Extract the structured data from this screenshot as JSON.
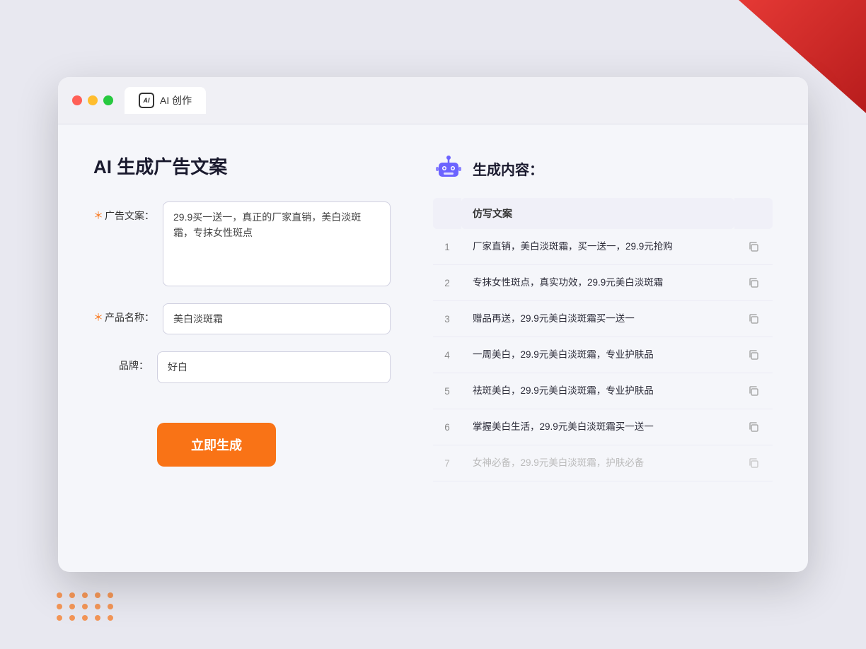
{
  "decorations": {
    "corner_color": "#e53935"
  },
  "browser": {
    "tab_label": "AI 创作",
    "tab_icon_text": "AI"
  },
  "left_panel": {
    "title": "AI 生成广告文案",
    "form": {
      "ad_copy_label": "广告文案：",
      "ad_copy_required": "＊",
      "ad_copy_value": "29.9买一送一，真正的厂家直销，美白淡斑霜，专抹女性斑点",
      "product_name_label": "产品名称：",
      "product_name_required": "＊",
      "product_name_value": "美白淡斑霜",
      "brand_label": "品牌：",
      "brand_value": "好白"
    },
    "generate_button": "立即生成"
  },
  "right_panel": {
    "title": "生成内容：",
    "column_header": "仿写文案",
    "results": [
      {
        "num": 1,
        "text": "厂家直销，美白淡斑霜，买一送一，29.9元抢购",
        "faded": false
      },
      {
        "num": 2,
        "text": "专抹女性斑点，真实功效，29.9元美白淡斑霜",
        "faded": false
      },
      {
        "num": 3,
        "text": "赠品再送，29.9元美白淡斑霜买一送一",
        "faded": false
      },
      {
        "num": 4,
        "text": "一周美白，29.9元美白淡斑霜，专业护肤品",
        "faded": false
      },
      {
        "num": 5,
        "text": "祛斑美白，29.9元美白淡斑霜，专业护肤品",
        "faded": false
      },
      {
        "num": 6,
        "text": "掌握美白生活，29.9元美白淡斑霜买一送一",
        "faded": false
      },
      {
        "num": 7,
        "text": "女神必备，29.9元美白淡斑霜，护肤必备",
        "faded": true
      }
    ]
  }
}
